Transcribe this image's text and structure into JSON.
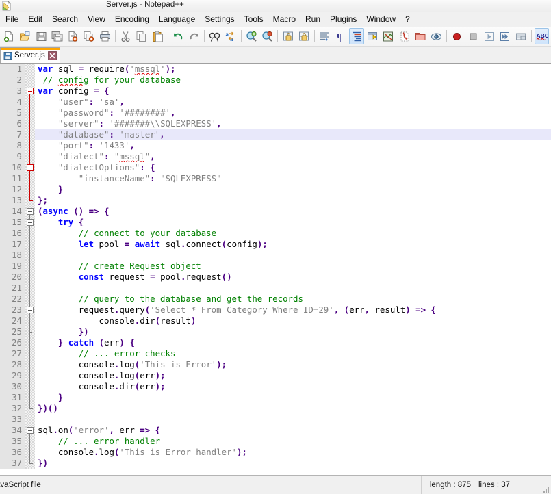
{
  "window": {
    "title": "Server.js - Notepad++",
    "app_icon": "notepad-plus-plus-icon"
  },
  "menubar": {
    "items": [
      {
        "label": "File"
      },
      {
        "label": "Edit"
      },
      {
        "label": "Search"
      },
      {
        "label": "View"
      },
      {
        "label": "Encoding"
      },
      {
        "label": "Language"
      },
      {
        "label": "Settings"
      },
      {
        "label": "Tools"
      },
      {
        "label": "Macro"
      },
      {
        "label": "Run"
      },
      {
        "label": "Plugins"
      },
      {
        "label": "Window"
      },
      {
        "label": "?"
      }
    ]
  },
  "toolbar": {
    "buttons": [
      {
        "name": "new-file-icon"
      },
      {
        "name": "open-file-icon"
      },
      {
        "name": "save-icon"
      },
      {
        "name": "save-all-icon"
      },
      {
        "name": "close-file-icon"
      },
      {
        "name": "close-all-files-icon"
      },
      {
        "name": "print-icon"
      },
      {
        "name": "separator"
      },
      {
        "name": "cut-icon"
      },
      {
        "name": "copy-icon"
      },
      {
        "name": "paste-icon"
      },
      {
        "name": "separator"
      },
      {
        "name": "undo-icon"
      },
      {
        "name": "redo-icon"
      },
      {
        "name": "separator"
      },
      {
        "name": "find-icon"
      },
      {
        "name": "replace-icon"
      },
      {
        "name": "separator"
      },
      {
        "name": "zoom-in-icon"
      },
      {
        "name": "zoom-out-icon"
      },
      {
        "name": "separator"
      },
      {
        "name": "sync-vertical-scroll-icon"
      },
      {
        "name": "sync-horizontal-scroll-icon"
      },
      {
        "name": "separator"
      },
      {
        "name": "word-wrap-icon"
      },
      {
        "name": "show-all-characters-icon"
      },
      {
        "name": "indent-guide-icon"
      },
      {
        "name": "user-defined-dialog-icon"
      },
      {
        "name": "document-map-icon"
      },
      {
        "name": "function-list-icon"
      },
      {
        "name": "folder-as-workspace-icon"
      },
      {
        "name": "monitoring-icon"
      },
      {
        "name": "separator"
      },
      {
        "name": "macro-record-icon"
      },
      {
        "name": "macro-stop-icon"
      },
      {
        "name": "macro-play-icon"
      },
      {
        "name": "macro-playback-multiple-icon"
      },
      {
        "name": "macro-save-icon"
      },
      {
        "name": "separator"
      },
      {
        "name": "spell-check-icon"
      }
    ]
  },
  "tabs": [
    {
      "label": "Server.js",
      "modified": false,
      "active": true
    }
  ],
  "editor": {
    "total_lines": 37,
    "current_line": 7,
    "lines": [
      {
        "n": 1,
        "text": "var sql = require('mssql');"
      },
      {
        "n": 2,
        "text": " // config for your database"
      },
      {
        "n": 3,
        "text": "var config = {"
      },
      {
        "n": 4,
        "text": "    \"user\": 'sa',"
      },
      {
        "n": 5,
        "text": "    \"password\": '########',"
      },
      {
        "n": 6,
        "text": "    \"server\": '#######\\\\SQLEXPRESS',"
      },
      {
        "n": 7,
        "text": "    \"database\": 'master',"
      },
      {
        "n": 8,
        "text": "    \"port\": '1433',"
      },
      {
        "n": 9,
        "text": "    \"dialect\": \"mssql\","
      },
      {
        "n": 10,
        "text": "    \"dialectOptions\": {"
      },
      {
        "n": 11,
        "text": "        \"instanceName\": \"SQLEXPRESS\""
      },
      {
        "n": 12,
        "text": "    }"
      },
      {
        "n": 13,
        "text": "};"
      },
      {
        "n": 14,
        "text": "(async () => {"
      },
      {
        "n": 15,
        "text": "    try {"
      },
      {
        "n": 16,
        "text": "        // connect to your database"
      },
      {
        "n": 17,
        "text": "        let pool = await sql.connect(config);"
      },
      {
        "n": 18,
        "text": ""
      },
      {
        "n": 19,
        "text": "        // create Request object"
      },
      {
        "n": 20,
        "text": "        const request = pool.request()"
      },
      {
        "n": 21,
        "text": ""
      },
      {
        "n": 22,
        "text": "        // query to the database and get the records"
      },
      {
        "n": 23,
        "text": "        request.query('Select * From Category Where ID=29', (err, result) => {"
      },
      {
        "n": 24,
        "text": "            console.dir(result)"
      },
      {
        "n": 25,
        "text": "        })"
      },
      {
        "n": 26,
        "text": "    } catch (err) {"
      },
      {
        "n": 27,
        "text": "        // ... error checks"
      },
      {
        "n": 28,
        "text": "        console.log('This is Error');"
      },
      {
        "n": 29,
        "text": "        console.log(err);"
      },
      {
        "n": 30,
        "text": "        console.dir(err);"
      },
      {
        "n": 31,
        "text": "    }"
      },
      {
        "n": 32,
        "text": "})()"
      },
      {
        "n": 33,
        "text": ""
      },
      {
        "n": 34,
        "text": "sql.on('error', err => {"
      },
      {
        "n": 35,
        "text": "    // ... error handler"
      },
      {
        "n": 36,
        "text": "    console.log('This is Error handler');"
      },
      {
        "n": 37,
        "text": "})"
      }
    ]
  },
  "statusbar": {
    "language": "avaScript file",
    "length_label": "length : 875",
    "lines_label": "lines : 37"
  },
  "colors": {
    "keyword": "#0000ff",
    "comment": "#008000",
    "string": "#808080",
    "operator": "#4b0082",
    "current_line_bg": "#e8e8fa",
    "tab_accent": "#ffa500",
    "gutter_bg": "#e4e4e4",
    "spell_underline": "#e00000"
  }
}
